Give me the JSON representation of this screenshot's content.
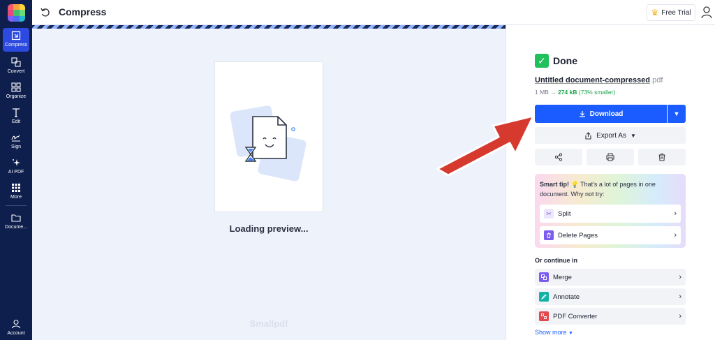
{
  "sidebar": {
    "items": [
      {
        "label": "Compress",
        "icon": "compress-icon"
      },
      {
        "label": "Convert",
        "icon": "convert-icon"
      },
      {
        "label": "Organize",
        "icon": "organize-icon"
      },
      {
        "label": "Edit",
        "icon": "edit-icon"
      },
      {
        "label": "Sign",
        "icon": "sign-icon"
      },
      {
        "label": "AI PDF",
        "icon": "sparkle-icon"
      },
      {
        "label": "More",
        "icon": "grid-icon"
      },
      {
        "label": "Docume...",
        "icon": "folder-icon"
      }
    ],
    "account_label": "Account"
  },
  "header": {
    "title": "Compress",
    "trial_label": "Free Trial"
  },
  "preview": {
    "loading_text": "Loading preview...",
    "watermark": "Smallpdf"
  },
  "panel": {
    "status": "Done",
    "file_name": "Untitled document-compressed",
    "file_ext": ".pdf",
    "size_before": "1 MB",
    "size_after": "274 kB",
    "size_saved": "(73% smaller)",
    "download_label": "Download",
    "export_label": "Export As",
    "tip_title": "Smart tip!",
    "tip_body": "That's a lot of pages in one document. Why not try:",
    "tip_actions": [
      {
        "label": "Split"
      },
      {
        "label": "Delete Pages"
      }
    ],
    "continue_label": "Or continue in",
    "continue_items": [
      {
        "label": "Merge"
      },
      {
        "label": "Annotate"
      },
      {
        "label": "PDF Converter"
      }
    ],
    "show_more_label": "Show more"
  },
  "colors": {
    "sidebar_bg": "#0f1f4d",
    "accent": "#1a5cff",
    "success": "#20c05c",
    "annotation_arrow": "#d63a2f"
  }
}
